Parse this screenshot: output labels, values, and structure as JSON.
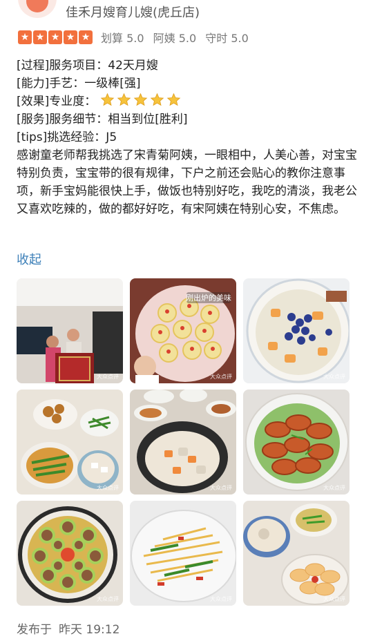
{
  "header": {
    "shop_name": "佳禾月嫂育儿嫂(虎丘店)",
    "star_count": 5,
    "scores": [
      "划算 5.0",
      "阿姨 5.0",
      "守时 5.0"
    ]
  },
  "review": {
    "lines": [
      "[过程]服务项目：42天月嫂",
      "[能力]手艺：一级棒[强]",
      "[效果]专业度：",
      "[服务]服务细节：相当到位[胜利]",
      "[tips]挑选经验：J5"
    ],
    "expertise_star_count": 5,
    "body": "感谢童老师帮我挑选了宋青菊阿姨，一眼相中，人美心善，对宝宝特别负责，宝宝带的很有规律，下户之前还会贴心的教你注意事项，新手宝妈能很快上手，做饭也特别好吃，我吃的清淡，我老公又喜欢吃辣的，做的都好好吃，有宋阿姨在特别心安，不焦虑。",
    "collapse_label": "收起"
  },
  "photos": {
    "watermark": "大众点评",
    "overlay_caption": "刚出炉的美味",
    "items": [
      "living-room-banner-photo",
      "steamed-egg-dish-photo",
      "blueberry-dessert-photo",
      "home-meal-table-photo",
      "pot-soup-table-photo",
      "braised-shrimp-photo",
      "stuffed-bitter-melon-photo",
      "shredded-potato-photo",
      "soup-bowls-photo"
    ]
  },
  "footer": {
    "published_label": "发布于",
    "published_time": "昨天 19:12"
  },
  "colors": {
    "star_orange": "#f2703d",
    "link_blue": "#3c7fb8",
    "emoji_star": "#f6c33c"
  }
}
